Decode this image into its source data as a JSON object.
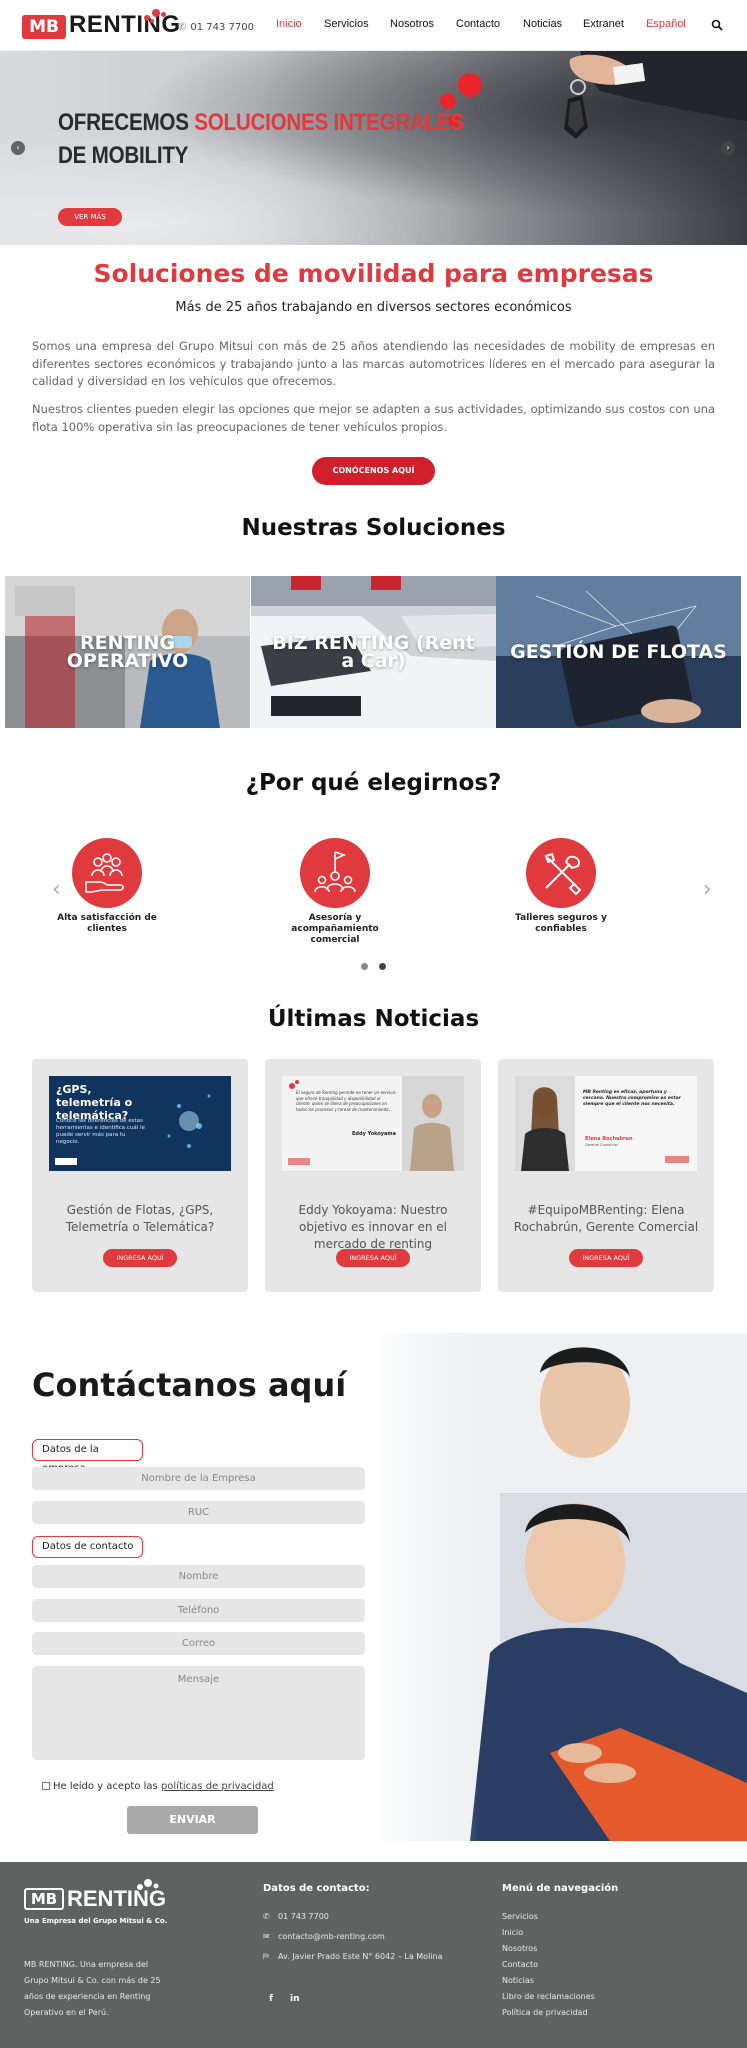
{
  "header": {
    "logo_mb": "MB",
    "logo_renting": "RENTING",
    "phone": "01 743 7700",
    "nav": [
      {
        "label": "Inicio",
        "active": true
      },
      {
        "label": "Servicios"
      },
      {
        "label": "Nosotros"
      },
      {
        "label": "Contacto"
      },
      {
        "label": "Noticias"
      },
      {
        "label": "Extranet"
      },
      {
        "label": "Español",
        "lang": true
      }
    ]
  },
  "hero": {
    "title_line1_dark": "OFRECEMOS ",
    "title_line1_red": "SOLUCIONES INTEGRALES",
    "title_line2": "DE MOBILITY",
    "button": "VER MÁS"
  },
  "intro": {
    "title": "Soluciones de movilidad para empresas",
    "subtitle": "Más de 25 años trabajando en diversos sectores económicos",
    "p1": "Somos una empresa del Grupo Mitsui con más de 25 años atendiendo las necesidades de mobility de empresas en diferentes sectores económicos y trabajando junto a las marcas automotrices líderes en el mercado para asegurar la calidad y diversidad en los vehículos que ofrecemos.",
    "p2": "Nuestros clientes pueden elegir las opciones que mejor se adapten a sus actividades, optimizando sus costos con una flota 100% operativa sin las preocupaciones de tener vehículos propios.",
    "cta": "CONÓCENOS AQUÍ"
  },
  "solutions": {
    "title": "Nuestras Soluciones",
    "items": [
      "RENTING OPERATIVO",
      "BIZ RENTING (Rent a Car)",
      "GESTIÓN DE FLOTAS"
    ]
  },
  "why": {
    "title": "¿Por qué elegirnos?",
    "items": [
      {
        "label": "Alta satisfacción de clientes",
        "icon": "hand-people-icon"
      },
      {
        "label": "Asesoría y acompañamiento comercial",
        "icon": "flag-team-icon"
      },
      {
        "label": "Talleres seguros y confiables",
        "icon": "tools-icon"
      }
    ]
  },
  "news": {
    "title": "Últimas Noticias",
    "button": "INGRESA AQUÍ",
    "items": [
      {
        "title": "Gestión de Flotas, ¿GPS, Telemetría o Telemática?",
        "img_heading": "¿GPS, telemetría o telemática?",
        "img_text": "Conoce las diferencias de estas herramientas e identifica cuál le puede servir más para tu negocio."
      },
      {
        "title": "Eddy Yokoyama: Nuestro objetivo es innovar en el mercado de renting",
        "img_quote": "El seguro de Renting permite no tener un servicio que ofrece tranquilidad y disponibilidad al cliente, quien se libera de preocupaciones en todos los procesos y tareas de mantenimiento.",
        "img_name": "Eddy Yokoyama"
      },
      {
        "title": "#EquipoMBRenting: Elena Rochabrún, Gerente Comercial",
        "img_quote": "MB Renting es eficaz, oportuna y cercana. Nuestro compromiso es estar siempre que el cliente nos necesita.",
        "img_name": "Elena Rochabrun",
        "img_role": "Gerente Comercial"
      }
    ]
  },
  "contact": {
    "title": "Contáctanos aquí",
    "company_group": "Datos de la empresa",
    "company_name_placeholder": "Nombre de la Empresa",
    "ruc_placeholder": "RUC",
    "contact_group": "Datos de contacto",
    "name_placeholder": "Nombre",
    "phone_placeholder": "Teléfono",
    "email_placeholder": "Correo",
    "message_placeholder": "Mensaje",
    "privacy_text": "He leído y acepto las ",
    "privacy_link": "políticas de privacidad",
    "send": "ENVIAR"
  },
  "footer": {
    "logo_mb": "MB",
    "logo_renting": "RENTING",
    "tagline": "Una Empresa del Grupo Mitsui & Co.",
    "about": "MB RENTING. Una empresa del Grupo Mitsui & Co. con más de 25 años de experiencia en Renting Operativo en el Perú.",
    "contact_heading": "Datos de contacto:",
    "phone": "01 743 7700",
    "email": "contacto@mb-renting.com",
    "address": "Av. Javier Prado Este N° 6042 – La Molina",
    "social_facebook": "f",
    "social_linkedin": "in",
    "nav_heading": "Menú de navegación",
    "nav_links": [
      "Servicios",
      "Inicio",
      "Nosotros",
      "Contacto",
      "Noticias",
      "Libro de reclamaciones",
      "Política de privacidad"
    ]
  },
  "colors": {
    "brand_red": "#e03a3e",
    "footer_bg": "#5e6362",
    "field_bg": "#e6e6e6"
  }
}
